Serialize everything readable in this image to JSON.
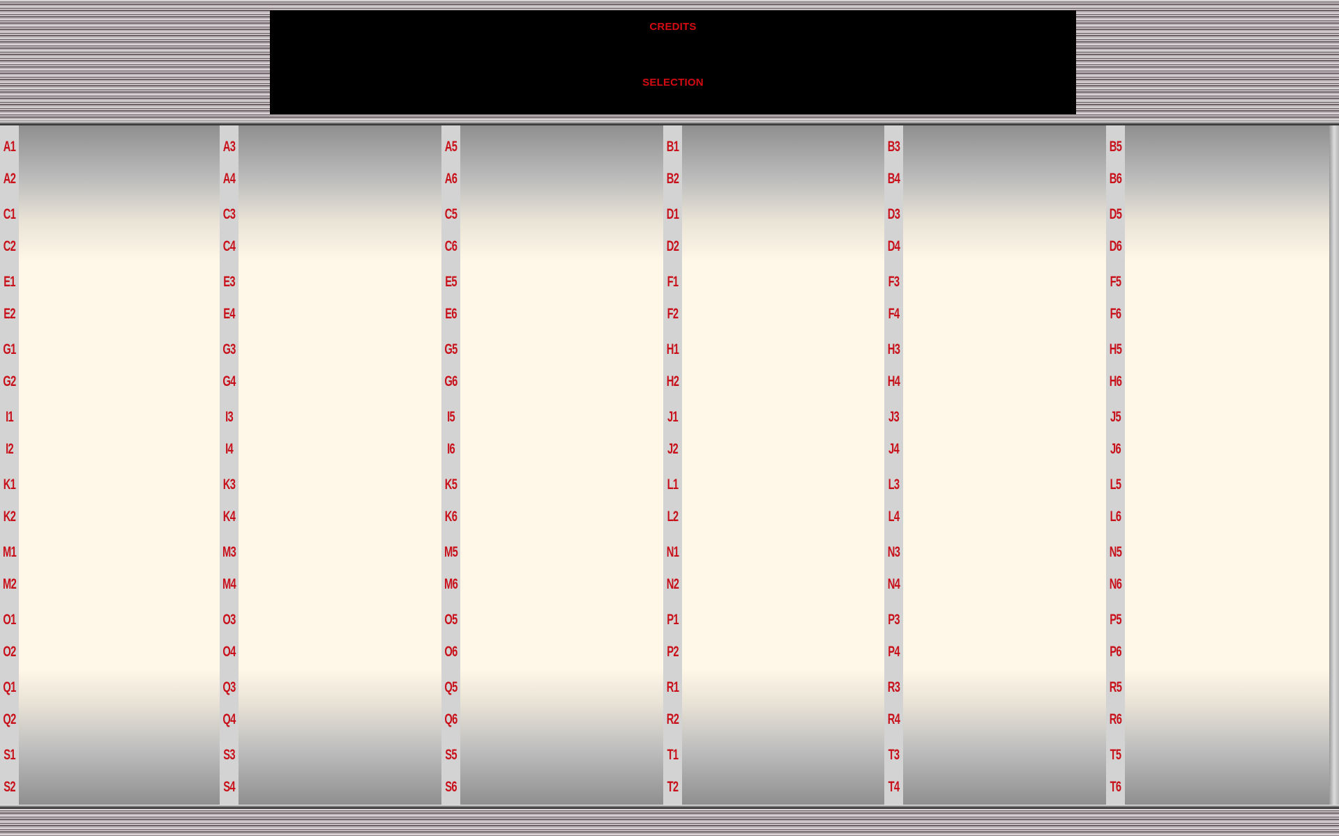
{
  "display": {
    "credits_label": "CREDITS",
    "selection_label": "SELECTION"
  },
  "columns": [
    {
      "labels": [
        "A1",
        "A2",
        "C1",
        "C2",
        "E1",
        "E2",
        "G1",
        "G2",
        "I1",
        "I2",
        "K1",
        "K2",
        "M1",
        "M2",
        "O1",
        "O2",
        "Q1",
        "Q2",
        "S1",
        "S2"
      ]
    },
    {
      "labels": [
        "A3",
        "A4",
        "C3",
        "C4",
        "E3",
        "E4",
        "G3",
        "G4",
        "I3",
        "I4",
        "K3",
        "K4",
        "M3",
        "M4",
        "O3",
        "O4",
        "Q3",
        "Q4",
        "S3",
        "S4"
      ]
    },
    {
      "labels": [
        "A5",
        "A6",
        "C5",
        "C6",
        "E5",
        "E6",
        "G5",
        "G6",
        "I5",
        "I6",
        "K5",
        "K6",
        "M5",
        "M6",
        "O5",
        "O6",
        "Q5",
        "Q6",
        "S5",
        "S6"
      ]
    },
    {
      "labels": [
        "B1",
        "B2",
        "D1",
        "D2",
        "F1",
        "F2",
        "H1",
        "H2",
        "J1",
        "J2",
        "L1",
        "L2",
        "N1",
        "N2",
        "P1",
        "P2",
        "R1",
        "R2",
        "T1",
        "T2"
      ]
    },
    {
      "labels": [
        "B3",
        "B4",
        "D3",
        "D4",
        "F3",
        "F4",
        "H3",
        "H4",
        "J3",
        "J4",
        "L3",
        "L4",
        "N3",
        "N4",
        "P3",
        "P4",
        "R3",
        "R4",
        "T3",
        "T4"
      ]
    },
    {
      "labels": [
        "B5",
        "B6",
        "D5",
        "D6",
        "F5",
        "F6",
        "H5",
        "H6",
        "J5",
        "J6",
        "L5",
        "L6",
        "N5",
        "N6",
        "P5",
        "P6",
        "R5",
        "R6",
        "T5",
        "T6"
      ]
    }
  ],
  "colors": {
    "label_red": "#c8101a",
    "display_bg": "#000000",
    "card_cream": "#fff7e8"
  }
}
